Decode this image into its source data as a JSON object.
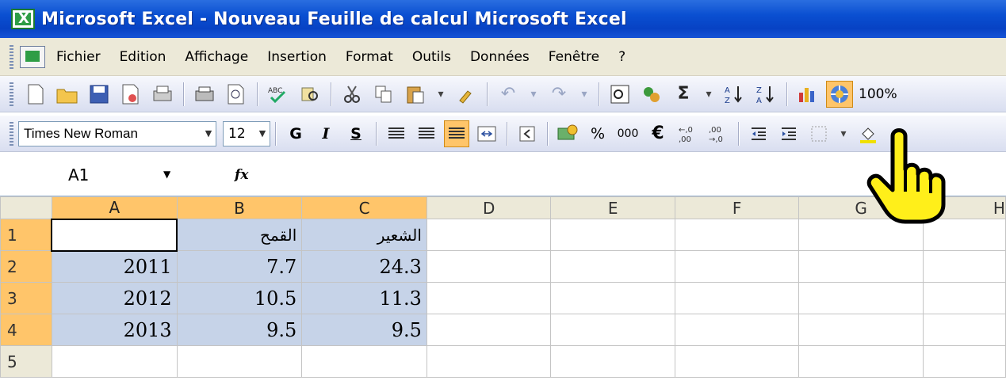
{
  "window": {
    "title": "Microsoft Excel - Nouveau Feuille de calcul Microsoft Excel"
  },
  "menu": [
    "Fichier",
    "Edition",
    "Affichage",
    "Insertion",
    "Format",
    "Outils",
    "Données",
    "Fenêtre",
    "?"
  ],
  "toolbar": {
    "zoom": "100%"
  },
  "format_toolbar": {
    "font": "Times New Roman",
    "size": "12",
    "bold": "G",
    "italic": "I",
    "underline": "S",
    "percent": "%",
    "thousands": "000",
    "euro": "€",
    "inc_decimal": "+,0\n,00",
    "dec_decimal": ",00\n→,0"
  },
  "formula_bar": {
    "name_box": "A1",
    "fx": "fx"
  },
  "grid": {
    "columns": [
      "A",
      "B",
      "C",
      "D",
      "E",
      "F",
      "G",
      "H"
    ],
    "rows": [
      {
        "num": "1",
        "cells": [
          "",
          "القمح",
          "الشعير"
        ]
      },
      {
        "num": "2",
        "cells": [
          "2011",
          "7.7",
          "24.3"
        ]
      },
      {
        "num": "3",
        "cells": [
          "2012",
          "10.5",
          "11.3"
        ]
      },
      {
        "num": "4",
        "cells": [
          "2013",
          "9.5",
          "9.5"
        ]
      },
      {
        "num": "5",
        "cells": [
          "",
          "",
          ""
        ]
      }
    ]
  },
  "colors": {
    "title_bar": "#0a4fd1",
    "selection": "#c6d3e8",
    "header_selected": "#ffc56a"
  }
}
